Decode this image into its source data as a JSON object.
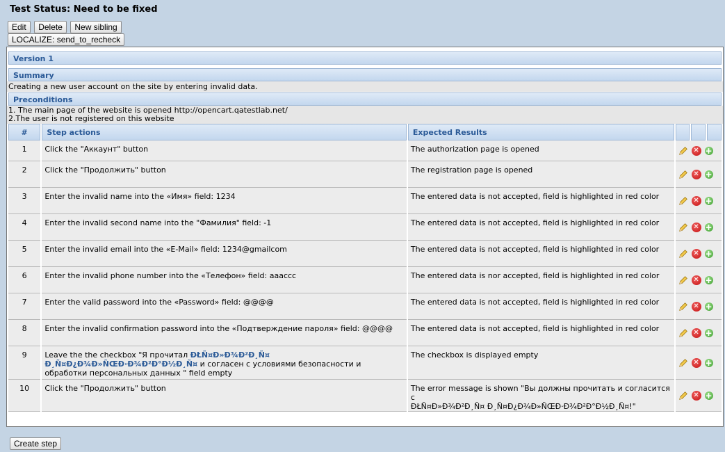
{
  "page": {
    "title": "Test Status: Need to be fixed"
  },
  "toolbar": {
    "edit_label": "Edit",
    "delete_label": "Delete",
    "new_sibling_label": "New sibling",
    "localize_label": "LOCALIZE: send_to_recheck"
  },
  "sections": {
    "version": "Version 1",
    "summary_header": "Summary",
    "summary_text": "Creating a new user account on the site by entering invalid data.",
    "preconditions_header": "Preconditions",
    "preconditions_line1": "1. The main page of the website is opened http://opencart.qatestlab.net/",
    "preconditions_line2": "2.The user is not registered on this website"
  },
  "table": {
    "col_num": "#",
    "col_actions": "Step actions",
    "col_results": "Expected Results"
  },
  "steps": [
    {
      "num": "1",
      "action": "Click the \"Аккаунт\" button",
      "result": "The authorization page is opened"
    },
    {
      "num": "2",
      "action": "Click the \"Продолжить\" button",
      "result": "The registration page is opened"
    },
    {
      "num": "3",
      "action": "Enter the invalid name into the «Имя» field: 1234",
      "result": "The entered data is not accepted, field is highlighted in red color"
    },
    {
      "num": "4",
      "action": "Enter the invalid second name into the \"Фамилия\" field: -1",
      "result": "The entered data is not accepted, field is highlighted in red color"
    },
    {
      "num": "5",
      "action": "Enter the invalid email into the «E-Mail» field: 1234@gmailcom",
      "result": "The entered data is not accepted, field is highlighted in red color"
    },
    {
      "num": "6",
      "action": "Enter the invalid phone number into the «Телефон» field: aaaccc",
      "result": "The entered data is nor accepted, field is highlighted in red color"
    },
    {
      "num": "7",
      "action": "Enter the valid password into the «Password» field: @@@@",
      "result": "The entered data is not accepted, field is highlighted in red color"
    },
    {
      "num": "8",
      "action": "Enter the invalid confirmation password into the «Подтверждение пароля» field: @@@@",
      "result": "The entered data is not accepted, field is highlighted in red color"
    },
    {
      "num": "9",
      "action_pre": "Leave the the checkbox \"Я прочитал ",
      "action_garbled": "ĐŁÑ¤Đ»Đ¾Đ²Đ¸Ñ¤ Đ¸Ñ¤Đ¿Đ¾Đ»ÑŒĐ·Đ¾Đ²Đ°Đ½Đ¸Ñ¤",
      "action_post": " и согласен с условиями безопасности и обработки персональных данных \" field empty",
      "result": "The checkbox is displayed empty"
    },
    {
      "num": "10",
      "action": "Click the \"Продолжить\" button",
      "result_line1": "The error message is shown \"Вы должны прочитать и согласится с",
      "result_line2": "ĐŁÑ¤Đ»Đ¾Đ²Đ¸Ñ¤ Đ¸Ñ¤Đ¿Đ¾Đ»ÑŒĐ·Đ¾Đ²Đ°Đ½Đ¸Ñ¤!\""
    }
  ],
  "icons": {
    "edit": "pencil-icon",
    "delete": "red-x-icon",
    "add": "green-plus-icon",
    "delete_glyph": "✕",
    "add_glyph": "+"
  },
  "footer": {
    "create_step_label": "Create step"
  }
}
